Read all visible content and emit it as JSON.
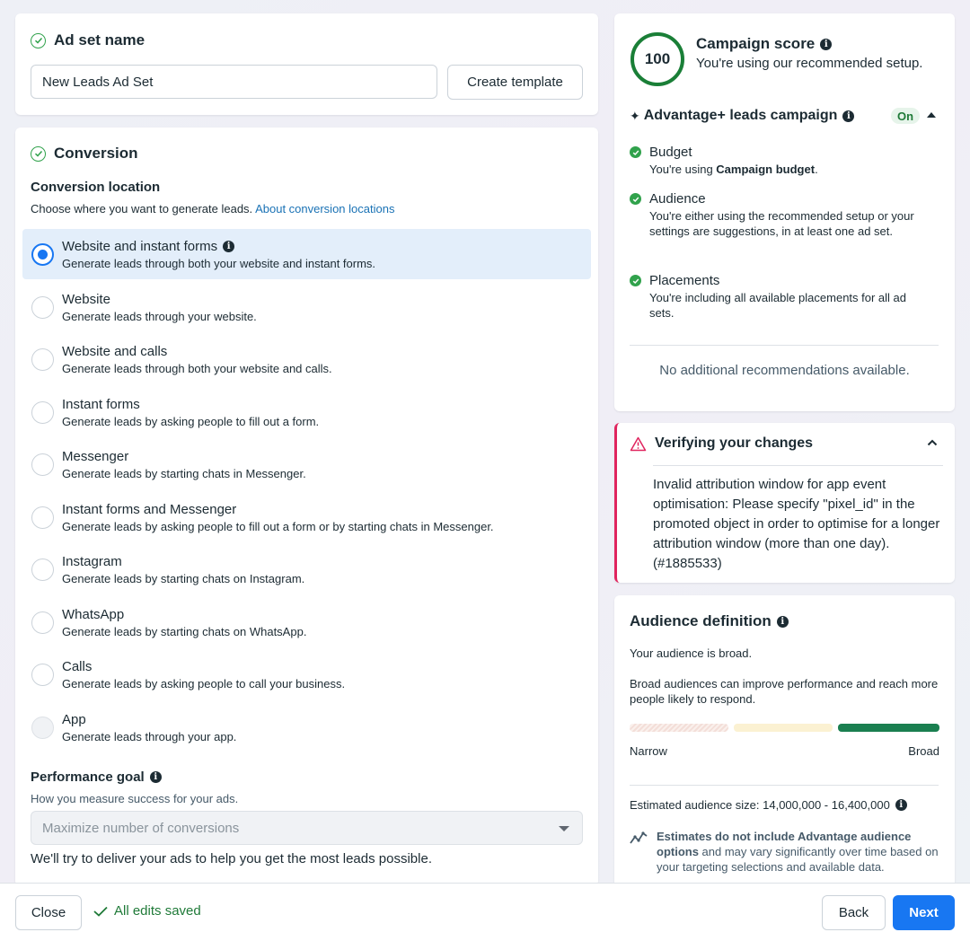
{
  "adset": {
    "title": "Ad set name",
    "name_value": "New Leads Ad Set",
    "create_template_label": "Create template"
  },
  "conversion": {
    "title": "Conversion",
    "location_heading": "Conversion location",
    "location_helper": "Choose where you want to generate leads.",
    "location_link": "About conversion locations",
    "options": [
      {
        "title": "Website and instant forms",
        "desc": "Generate leads through both your website and instant forms.",
        "selected": true,
        "has_info": true
      },
      {
        "title": "Website",
        "desc": "Generate leads through your website."
      },
      {
        "title": "Website and calls",
        "desc": "Generate leads through both your website and calls."
      },
      {
        "title": "Instant forms",
        "desc": "Generate leads by asking people to fill out a form."
      },
      {
        "title": "Messenger",
        "desc": "Generate leads by starting chats in Messenger."
      },
      {
        "title": "Instant forms and Messenger",
        "desc": "Generate leads by asking people to fill out a form or by starting chats in Messenger."
      },
      {
        "title": "Instagram",
        "desc": "Generate leads by starting chats on Instagram."
      },
      {
        "title": "WhatsApp",
        "desc": "Generate leads by starting chats on WhatsApp."
      },
      {
        "title": "Calls",
        "desc": "Generate leads by asking people to call your business."
      },
      {
        "title": "App",
        "desc": "Generate leads through your app.",
        "disabled": true
      }
    ],
    "goal_heading": "Performance goal",
    "goal_helper": "How you measure success for your ads.",
    "goal_value": "Maximize number of conversions",
    "goal_note": "We'll try to deliver your ads to help you get the most leads possible."
  },
  "score": {
    "value": "100",
    "fraction": 1.0,
    "title": "Campaign score",
    "subtitle": "You're using our recommended setup.",
    "advantage_title": "Advantage+ leads campaign",
    "advantage_status": "On",
    "items": [
      {
        "title": "Budget",
        "desc_prefix": "You're using ",
        "desc_bold": "Campaign budget",
        "desc_suffix": "."
      },
      {
        "title": "Audience",
        "desc": "You're either using the recommended setup or your settings are suggestions, in at least one ad set."
      },
      {
        "title": "Placements",
        "desc": "You're including all available placements for all ad sets."
      }
    ],
    "no_more": "No additional recommendations available."
  },
  "verify": {
    "title": "Verifying your changes",
    "message": "Invalid attribution window for app event optimisation: Please specify \"pixel_id\" in the promoted object in order to optimise for a longer attribution window (more than one day). (#1885533)"
  },
  "audience": {
    "title": "Audience definition",
    "status": "Your audience is broad.",
    "detail": "Broad audiences can improve performance and reach more people likely to respond.",
    "narrow_label": "Narrow",
    "broad_label": "Broad",
    "size_text": "Estimated audience size: 14,000,000 - 16,400,000",
    "estimate_bold": "Estimates do not include Advantage audience options",
    "estimate_rest": " and may vary significantly over time based on your targeting selections and available data.",
    "level": "broad"
  },
  "footer": {
    "close_label": "Close",
    "saved_label": "All edits saved",
    "back_label": "Back",
    "next_label": "Next"
  },
  "colors": {
    "primary": "#1877f2",
    "success": "#31a24c",
    "error": "#e0245e"
  }
}
